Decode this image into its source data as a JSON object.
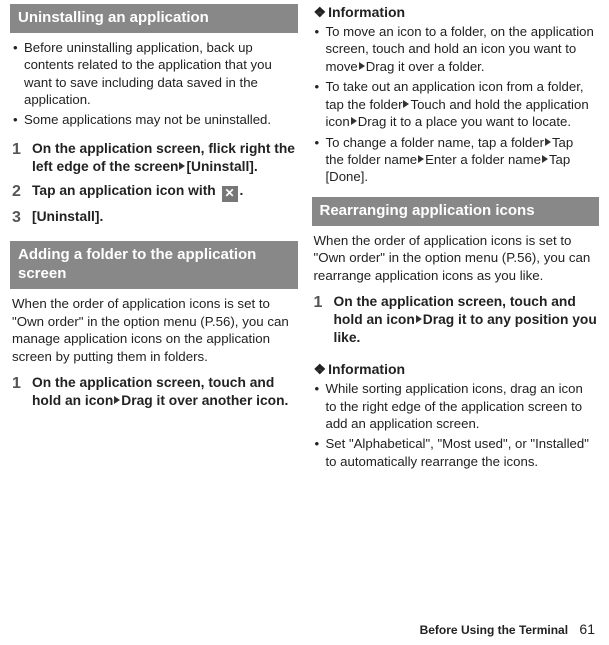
{
  "left": {
    "section1": {
      "title": "Uninstalling an application",
      "bullets": [
        "Before uninstalling application, back up contents related to the application that you want to save including data saved in the application.",
        "Some applications may not be uninstalled."
      ],
      "steps": {
        "s1_num": "1",
        "s1_text_a": "On the application screen, flick right the left edge of the screen",
        "s1_text_b": "[Uninstall].",
        "s2_num": "2",
        "s2_text_a": "Tap an application icon with ",
        "s2_text_b": ".",
        "s3_num": "3",
        "s3_text": "[Uninstall]."
      }
    },
    "section2": {
      "title": "Adding a folder to the application screen",
      "paragraph": "When the order of application icons is set to \"Own order\" in the option menu (P.56), you can manage application icons on the application screen by putting them in folders.",
      "steps": {
        "s1_num": "1",
        "s1_text_a": "On the application screen, touch and hold an icon",
        "s1_text_b": "Drag it over another icon."
      }
    }
  },
  "right": {
    "info1": {
      "heading": "Information",
      "b1_a": "To move an icon to a folder, on the application screen, touch and hold an icon you want to move",
      "b1_b": "Drag it over a folder.",
      "b2_a": "To take out an application icon from a folder, tap the folder",
      "b2_b": "Touch and hold the application icon",
      "b2_c": "Drag it to a place you want to locate.",
      "b3_a": "To change a folder name, tap a folder",
      "b3_b": "Tap the folder name",
      "b3_c": "Enter a folder name",
      "b3_d": "Tap [Done]."
    },
    "section3": {
      "title": "Rearranging application icons",
      "paragraph": "When the order of application icons is set to \"Own order\" in the option menu (P.56), you can rearrange application icons as you like.",
      "steps": {
        "s1_num": "1",
        "s1_text_a": "On the application screen, touch and hold an icon",
        "s1_text_b": "Drag it to any position you like."
      }
    },
    "info2": {
      "heading": "Information",
      "bullets": [
        "While sorting application icons, drag an icon to the right edge of the application screen to add an application screen.",
        "Set \"Alphabetical\", \"Most used\", or \"Installed\" to automatically rearrange the icons."
      ]
    }
  },
  "footer": {
    "label": "Before Using the Terminal",
    "page": "61"
  }
}
